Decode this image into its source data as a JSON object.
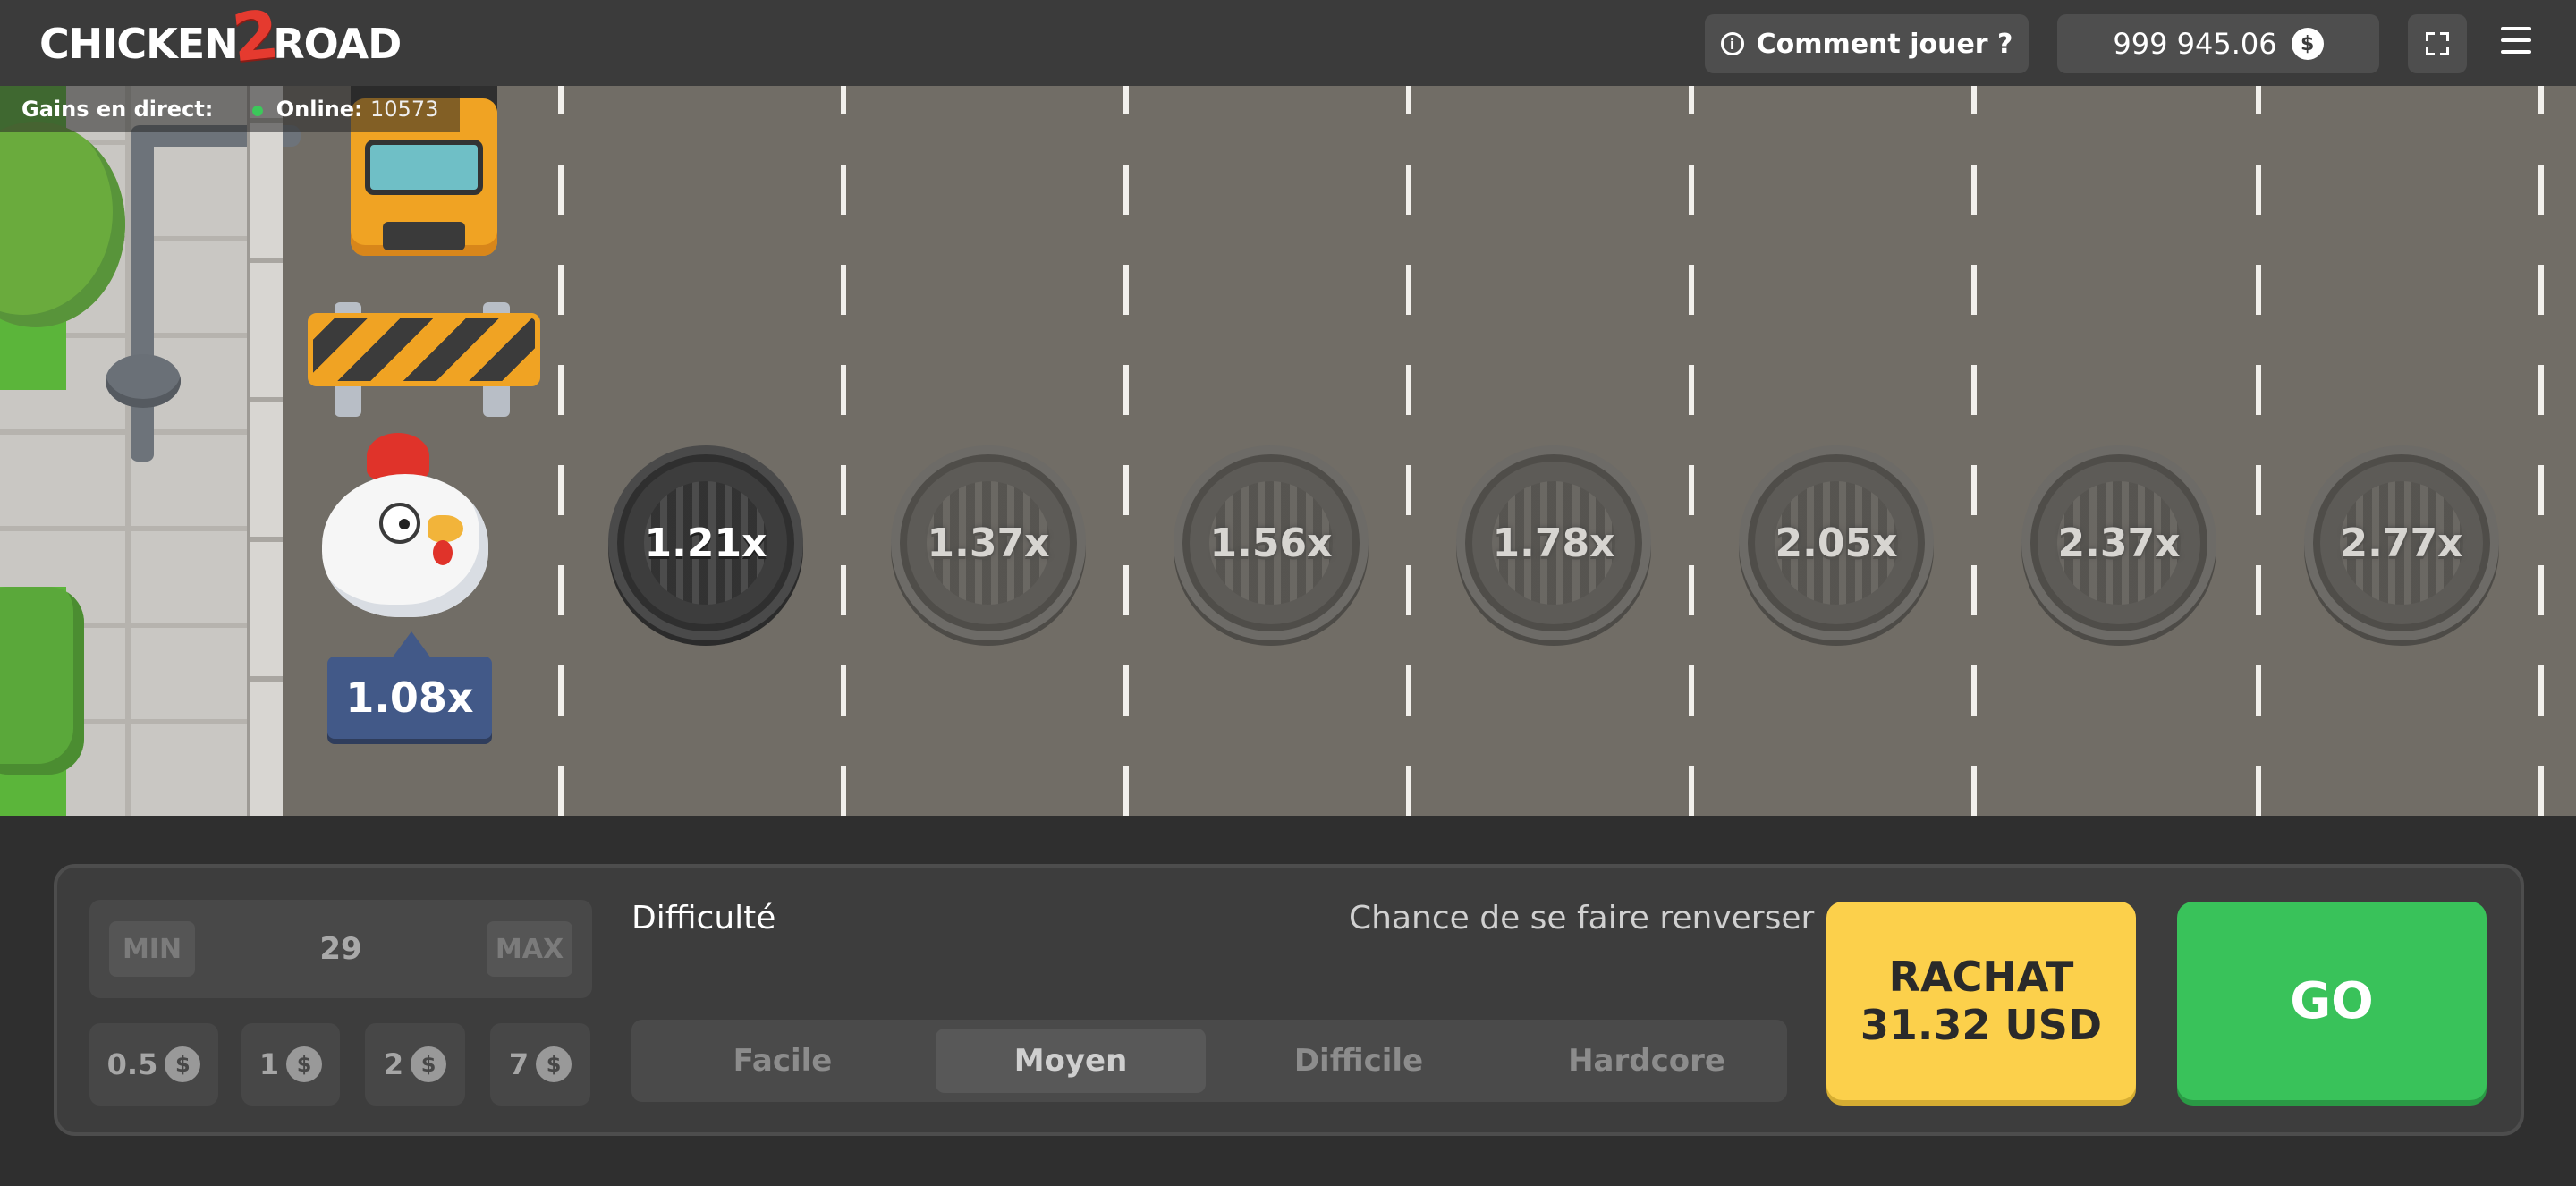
{
  "header": {
    "logo_part1": "CHICKEN",
    "logo_two": "2",
    "logo_part2": "ROAD",
    "how_to_play": "Comment jouer ?",
    "balance": "999 945.06",
    "currency_symbol": "$",
    "icons": [
      "info-icon",
      "coin-icon",
      "fullscreen-icon",
      "menu-icon"
    ]
  },
  "live_bar": {
    "label": "Gains en direct:",
    "online_label": "Online:",
    "online_count": "10573"
  },
  "game": {
    "chicken_multiplier": "1.08x",
    "multipliers": [
      "1.21x",
      "1.37x",
      "1.56x",
      "1.78x",
      "2.05x",
      "2.37x",
      "2.77x"
    ],
    "active_multiplier_index": 0
  },
  "controls": {
    "bet": {
      "min_label": "MIN",
      "max_label": "MAX",
      "value": "29",
      "chips": [
        "0.5",
        "1",
        "2",
        "7"
      ],
      "chip_currency": "$"
    },
    "difficulty_label": "Difficulté",
    "chance_label": "Chance de se faire renverser",
    "difficulties": [
      "Facile",
      "Moyen",
      "Difficile",
      "Hardcore"
    ],
    "selected_difficulty": "Moyen",
    "cashout_line1": "RACHAT",
    "cashout_line2": "31.32 USD",
    "go_label": "GO"
  },
  "colors": {
    "header_bg": "#3b3b3b",
    "road": "#716d66",
    "badge_blue": "#425988",
    "cashout_yellow": "#fcd04b",
    "go_green": "#39c25a",
    "live_dot": "#3cc85a"
  }
}
